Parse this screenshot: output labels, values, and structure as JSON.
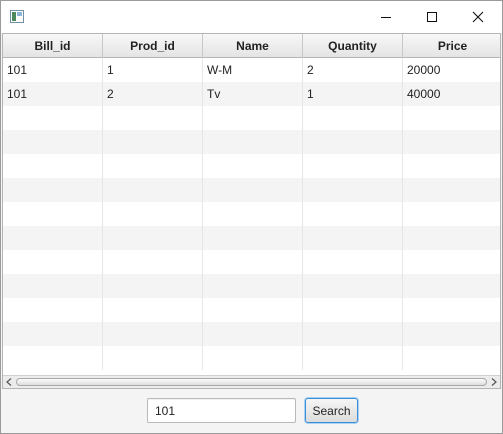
{
  "window": {
    "controls": {
      "minimize": "minimize-icon",
      "maximize": "maximize-icon",
      "close": "close-icon"
    }
  },
  "table": {
    "columns": [
      "Bill_id",
      "Prod_id",
      "Name",
      "Quantity",
      "Price"
    ],
    "rows": [
      [
        "101",
        "1",
        "W-M",
        "2",
        "20000"
      ],
      [
        "101",
        "2",
        "Tv",
        "1",
        "40000"
      ]
    ],
    "visible_row_count": 13
  },
  "search": {
    "input_value": "101",
    "button_label": "Search"
  },
  "colors": {
    "accent_focus": "#3c8fd6",
    "row_alt": "#f4f4f4",
    "header_bg": "#e4e4e4"
  }
}
